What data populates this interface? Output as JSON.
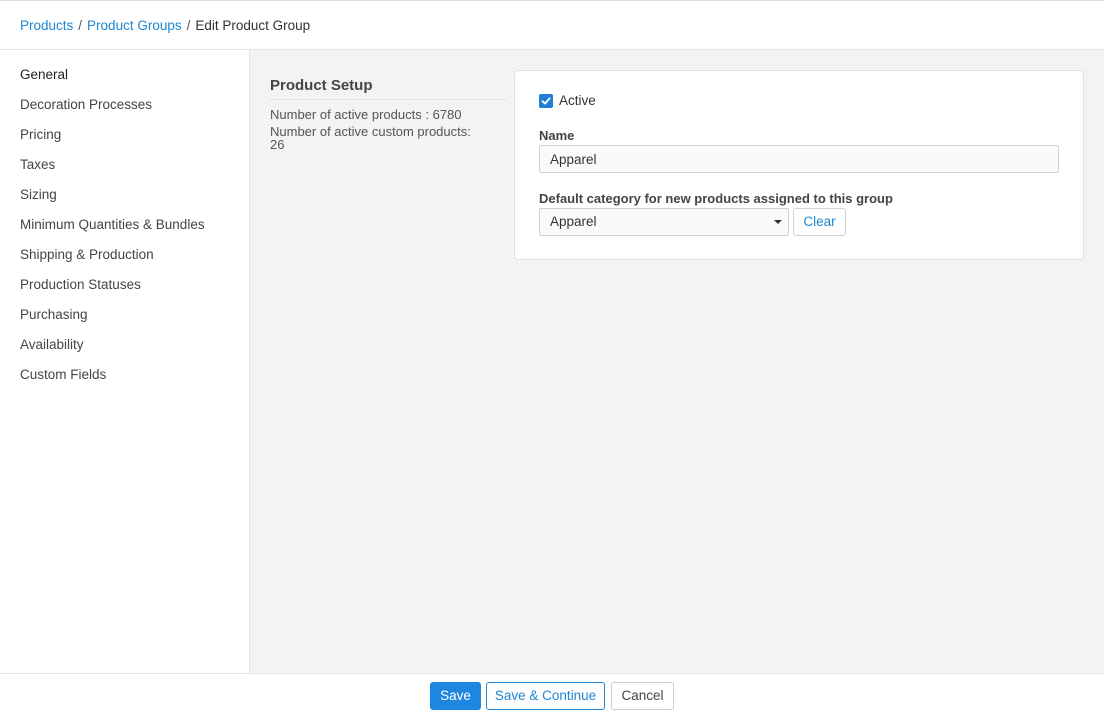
{
  "breadcrumb": {
    "items": [
      "Products",
      "Product Groups"
    ],
    "separator": "/",
    "current": "Edit Product Group"
  },
  "sidebar": {
    "items": [
      {
        "label": "General"
      },
      {
        "label": "Decoration Processes"
      },
      {
        "label": "Pricing"
      },
      {
        "label": "Taxes"
      },
      {
        "label": "Sizing"
      },
      {
        "label": "Minimum Quantities & Bundles"
      },
      {
        "label": "Shipping & Production"
      },
      {
        "label": "Production Statuses"
      },
      {
        "label": "Purchasing"
      },
      {
        "label": "Availability"
      },
      {
        "label": "Custom Fields"
      }
    ]
  },
  "setup": {
    "title": "Product Setup",
    "active_products": "Number of active products : 6780",
    "active_custom_label": "Number of active custom products:",
    "active_custom_value": "26"
  },
  "form": {
    "active_label": "Active",
    "active_checked": true,
    "name_label": "Name",
    "name_value": "Apparel",
    "category_label": "Default category for new products assigned to this group",
    "category_value": "Apparel",
    "clear_label": "Clear"
  },
  "footer": {
    "save_label": "Save",
    "save_continue_label": "Save & Continue",
    "cancel_label": "Cancel"
  },
  "colors": {
    "accent": "#1f86e0",
    "link": "#1f86d3",
    "page_bg": "#f2f3f5"
  }
}
